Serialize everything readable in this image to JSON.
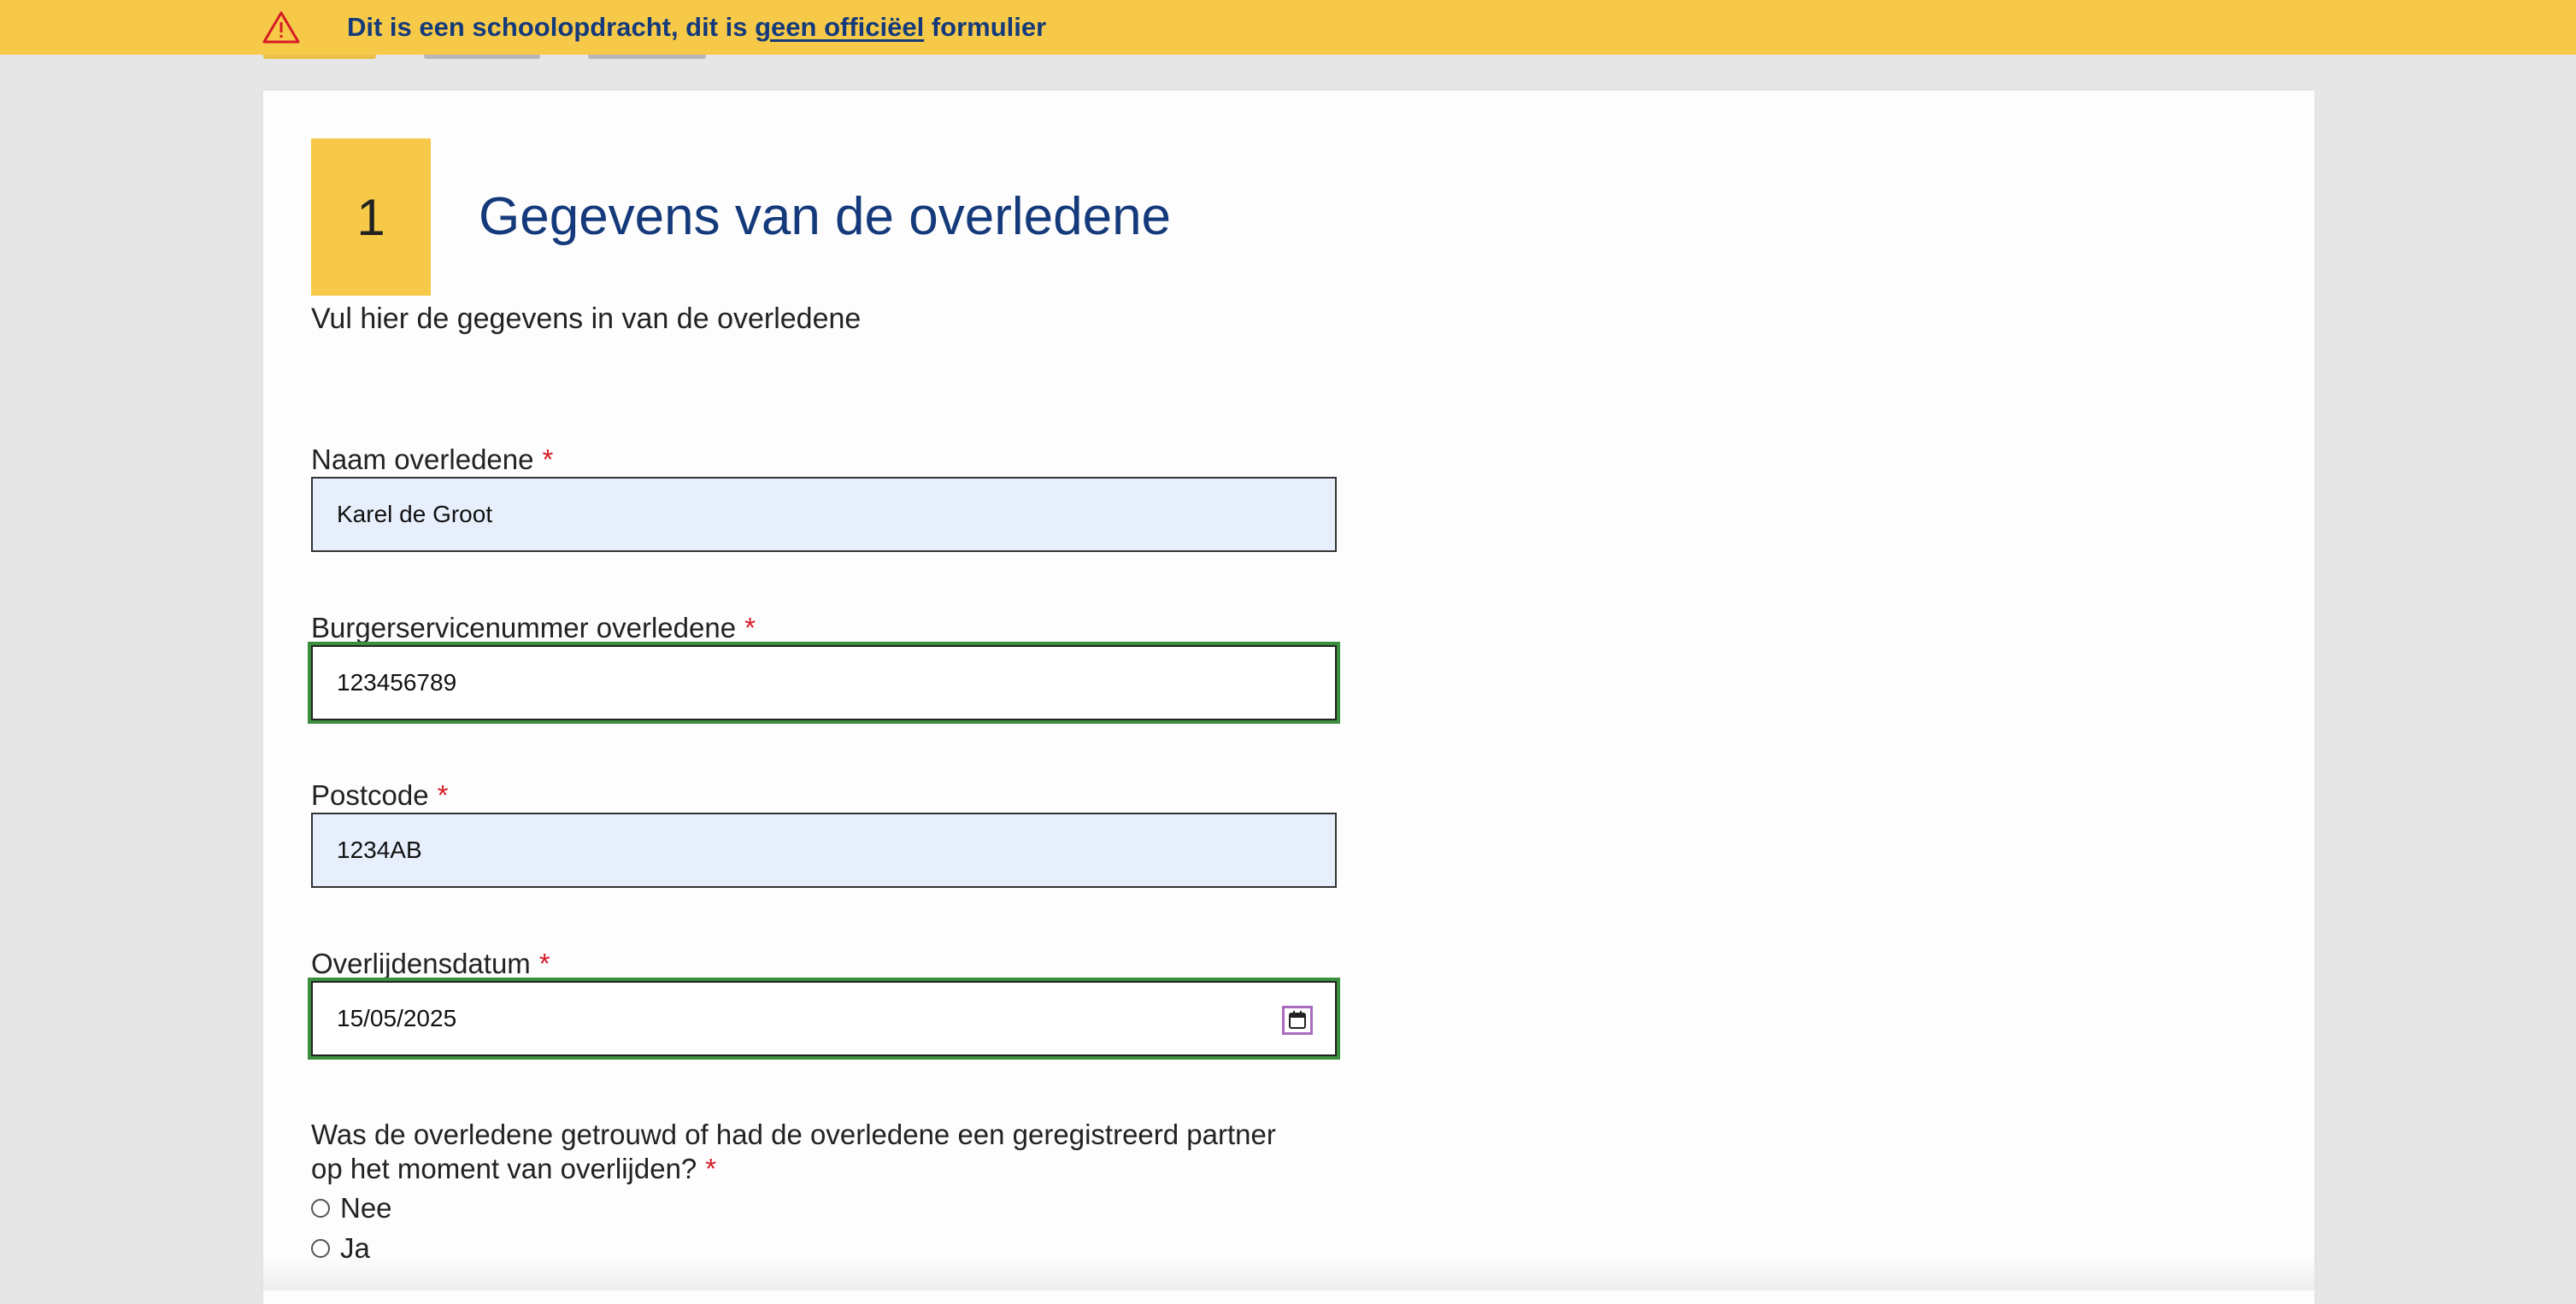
{
  "banner": {
    "icon": "warning-triangle-icon",
    "text_before": "Dit is een schoolopdracht, dit is ",
    "link_text": "geen officiëel",
    "text_after": " formulier",
    "background_color": "#f7c948",
    "text_color": "#143a7b"
  },
  "section": {
    "step_number": "1",
    "title": "Gegevens van de overledene",
    "description": "Vul hier de gegevens in van de overledene"
  },
  "fields": {
    "naam": {
      "label": "Naam overledene",
      "required_marker": "*",
      "value": "Karel de Groot"
    },
    "bsn": {
      "label": "Burgerservicenummer overledene",
      "required_marker": "*",
      "value": "123456789"
    },
    "postcode": {
      "label": "Postcode",
      "required_marker": "*",
      "value": "1234AB"
    },
    "overlijdensdatum": {
      "label": "Overlijdensdatum",
      "required_marker": "*",
      "value": "15/05/2025",
      "icon": "calendar-icon"
    }
  },
  "partner_question": {
    "text": "Was de overledene getrouwd of had de overledene een geregistreerd partner op het moment van overlijden?",
    "required_marker": "*",
    "options": [
      "Nee",
      "Ja"
    ]
  },
  "colors": {
    "accent_yellow": "#f7c948",
    "title_blue": "#143a7b",
    "focus_green": "#3c8f3f",
    "required_red": "#d51b26",
    "autofill_blue": "#e8effc"
  }
}
